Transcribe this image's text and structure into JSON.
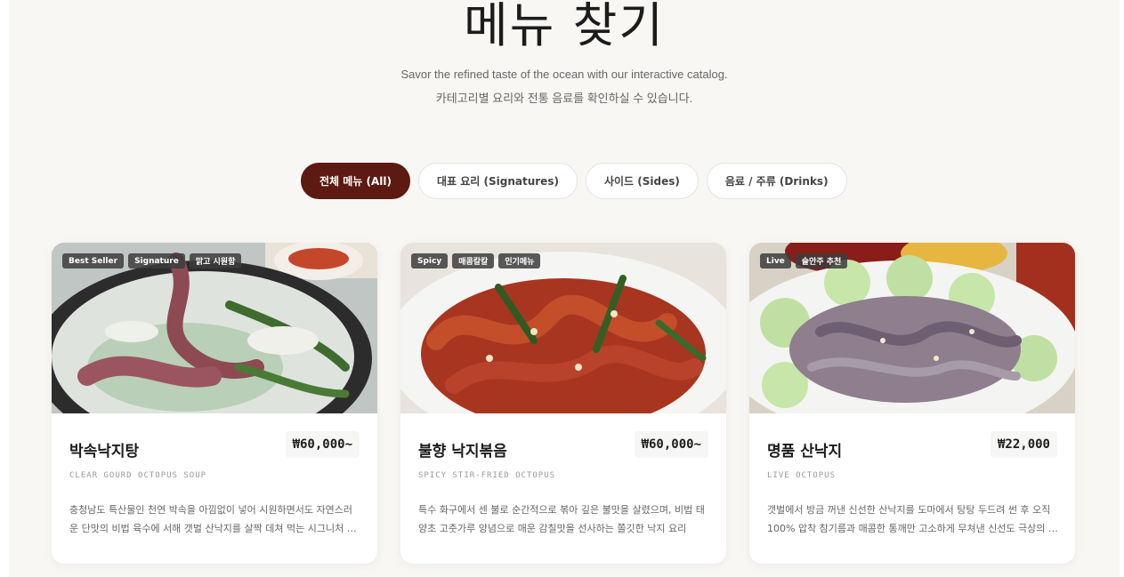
{
  "header": {
    "title": "메뉴 찾기",
    "subtitle_en": "Savor the refined taste of the ocean with our interactive catalog.",
    "subtitle_ko": "카테고리별 요리와 전통 음료를 확인하실 수 있습니다."
  },
  "tabs": [
    {
      "label": "전체 메뉴 (All)",
      "active": true
    },
    {
      "label": "대표 요리 (Signatures)",
      "active": false
    },
    {
      "label": "사이드 (Sides)",
      "active": false
    },
    {
      "label": "음료 / 주류 (Drinks)",
      "active": false
    }
  ],
  "cards": [
    {
      "badges": [
        "Best Seller",
        "Signature",
        "맑고 시원함"
      ],
      "name": "박속낙지탕",
      "price": "₩60,000~",
      "english": "CLEAR GOURD OCTOPUS SOUP",
      "description": "충청남도 특산물인 천연 박속을 아낌없이 넣어 시원하면서도 자연스러운 단맛의 비법 육수에 서해 갯벌 산낙지를 살짝 데쳐 먹는 시그니처 메뉴입니다."
    },
    {
      "badges": [
        "Spicy",
        "매콤칼칼",
        "인기메뉴"
      ],
      "name": "불향 낙지볶음",
      "price": "₩60,000~",
      "english": "SPICY STIR-FRIED OCTOPUS",
      "description": "특수 화구에서 센 불로 순간적으로 볶아 깊은 불맛을 살렸으며, 비법 태양초 고춧가루 양념으로 매운 감칠맛을 선사하는 쫄깃한 낙지 요리"
    },
    {
      "badges": [
        "Live",
        "술안주 추천"
      ],
      "name": "명품 산낙지",
      "price": "₩22,000",
      "english": "LIVE OCTOPUS",
      "description": "갯벌에서 방금 꺼낸 신선한 산낙지를 도마에서 탕탕 두드려 썬 후 오직 100% 압착 참기름과 매콤한 통깨만 고소하게 무쳐낸 신선도 극상의 메뉴입니다."
    }
  ],
  "colors": {
    "accent": "#5c1a12",
    "page_bg": "#f8f7f4"
  }
}
